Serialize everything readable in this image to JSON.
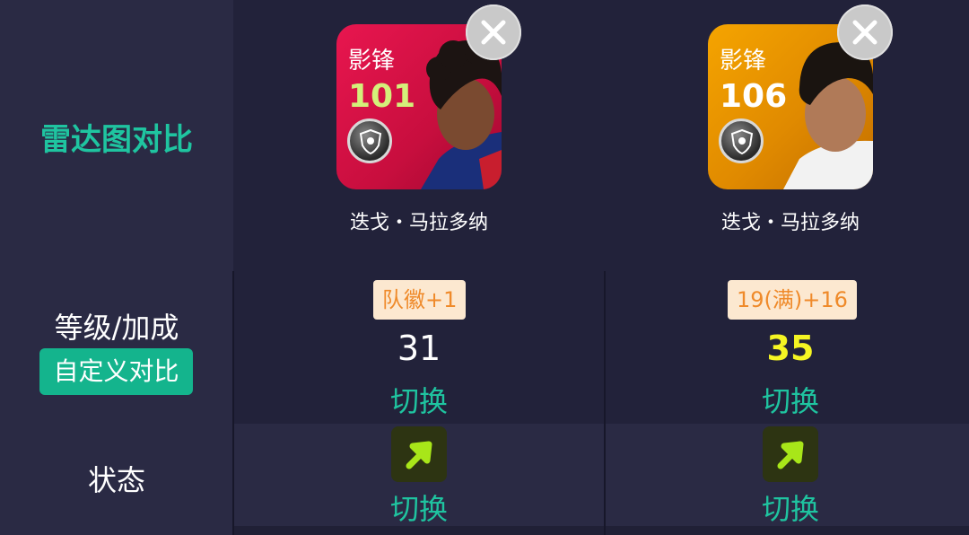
{
  "labels": {
    "radar_compare": "雷达图对比",
    "level_bonus": "等级/加成",
    "custom_compare": "自定义对比",
    "state": "状态"
  },
  "players": [
    {
      "position": "影锋",
      "rating": "101",
      "name": "迭戈・马拉多纳",
      "bonus_tag": "队徽+1",
      "level": "31",
      "level_color": "#ffffff",
      "switch_level": "切换",
      "switch_state": "切换",
      "card_color": "#e8164f",
      "state_icon": "arrow-up-right-icon"
    },
    {
      "position": "影锋",
      "rating": "106",
      "name": "迭戈・马拉多纳",
      "bonus_tag": "19(满)+16",
      "level": "35",
      "level_color": "#f5f523",
      "switch_level": "切换",
      "switch_state": "切换",
      "card_color": "#f5a400",
      "state_icon": "arrow-up-right-icon"
    }
  ],
  "colors": {
    "accent": "#1fc4a0",
    "button": "#14b48d",
    "tag_bg": "#fce8d0",
    "tag_text": "#ef8a2a",
    "arrow": "#a8e619"
  }
}
